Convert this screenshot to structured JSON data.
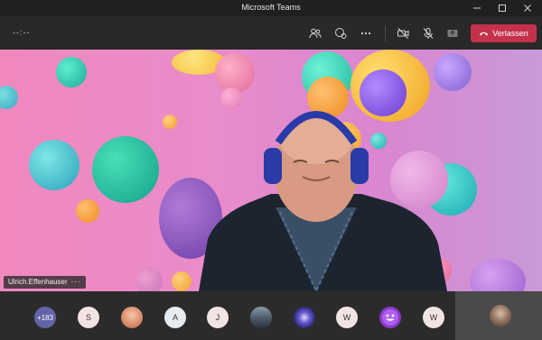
{
  "window": {
    "title": "Microsoft Teams"
  },
  "toolbar": {
    "timer": "--:--",
    "leave_label": "Verlassen",
    "buttons": [
      "participants-icon",
      "chat-icon",
      "more-options-icon",
      "camera-off-icon",
      "mic-muted-icon",
      "share-tray-icon"
    ]
  },
  "video": {
    "participant_name": "Ulrich.Effenhauser",
    "more": "···"
  },
  "gallery": {
    "overflow_count": "+183",
    "avatars": [
      {
        "initial": "S",
        "bg": "#f4e3e3"
      },
      {
        "initial": "",
        "bg": "#d98a6a",
        "type": "photo"
      },
      {
        "initial": "A",
        "bg": "#e6ecef"
      },
      {
        "initial": "J",
        "bg": "#f2e4e4"
      },
      {
        "initial": "",
        "bg": "#5a6a78",
        "type": "photo"
      },
      {
        "initial": "",
        "bg": "#3a3a9a",
        "type": "photo"
      },
      {
        "initial": "W",
        "bg": "#f2e4e4"
      },
      {
        "initial": "",
        "bg": "#8a3ac8",
        "type": "emoji"
      },
      {
        "initial": "W",
        "bg": "#f2e4e4"
      }
    ]
  },
  "colors": {
    "leave": "#c4314b",
    "toolbar": "#292929",
    "overflow_badge": "#6264a7"
  }
}
